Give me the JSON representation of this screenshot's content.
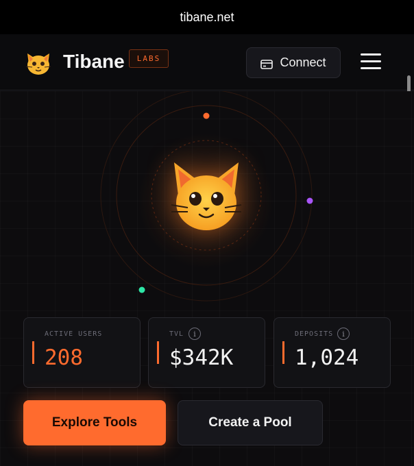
{
  "browser": {
    "url": "tibane.net"
  },
  "header": {
    "brand_name": "Tibane",
    "brand_badge": "LABS",
    "brand_icon": "cat-face-icon",
    "connect_label": "Connect",
    "connect_icon": "wallet-card-icon",
    "menu_icon": "hamburger-menu-icon"
  },
  "hero": {
    "mascot_icon": "cat-face-icon",
    "orbit_dot_colors": [
      "#ff6b2e",
      "#a855f7",
      "#2ee6a6"
    ]
  },
  "stats": [
    {
      "label": "ACTIVE USERS",
      "value": "208",
      "value_color": "#ff6b2e",
      "info": false
    },
    {
      "label": "TVL",
      "value": "$342K",
      "value_color": "#f2f2f2",
      "info": true,
      "info_icon": "info-icon"
    },
    {
      "label": "DEPOSITS",
      "value": "1,024",
      "value_color": "#f2f2f2",
      "info": true,
      "info_icon": "info-icon"
    }
  ],
  "actions": {
    "primary_label": "Explore Tools",
    "secondary_label": "Create a Pool"
  },
  "colors": {
    "accent": "#ff6b2e",
    "background": "#0a0a0c",
    "card": "#121215"
  }
}
